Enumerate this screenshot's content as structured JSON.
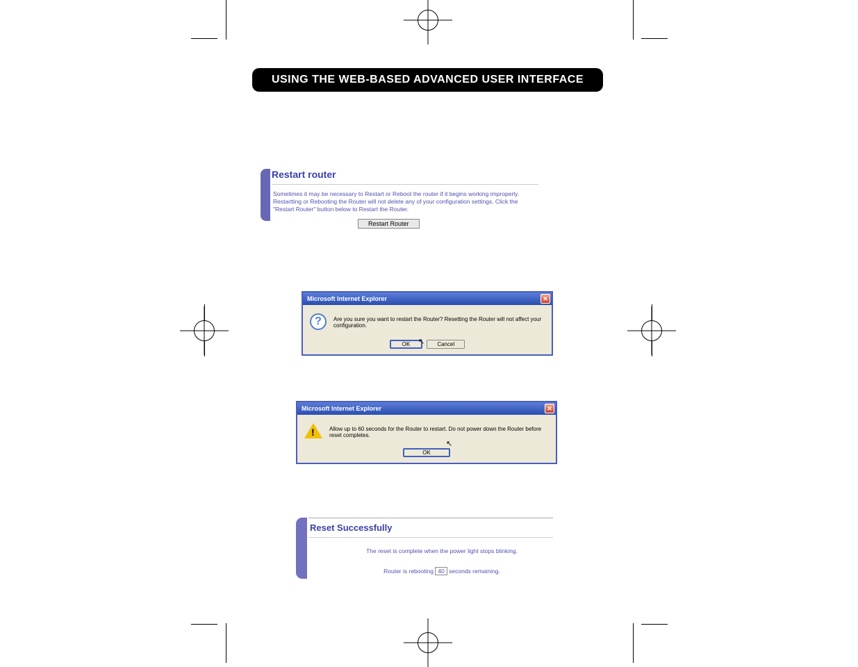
{
  "header": {
    "title": "USING THE WEB-BASED ADVANCED USER INTERFACE"
  },
  "restart_panel": {
    "title": "Restart router",
    "body": "Sometimes it may be necessary to Restart or Reboot the router if it begins working improperly. Restartting or Rebooting the Router will not delete any of your configuration settings. Click the \"Restart Router\" button below to Restart the Router.",
    "button_label": "Restart Router"
  },
  "dialog1": {
    "title": "Microsoft Internet Explorer",
    "message": "Are you sure you want to restart the Router? Resetting the Router will not affect your configuration.",
    "ok_label": "OK",
    "cancel_label": "Cancel"
  },
  "dialog2": {
    "title": "Microsoft Internet Explorer",
    "message": "Allow up to 60 seconds for the Router to restart. Do not power down the Router before reset completes.",
    "ok_label": "OK"
  },
  "reset_panel": {
    "title": "Reset Successfully",
    "line1": "The reset is complete when the power light stops blinking.",
    "line2_pre": "Router is rebooting ",
    "countdown": "40",
    "line2_post": " seconds remaining."
  }
}
